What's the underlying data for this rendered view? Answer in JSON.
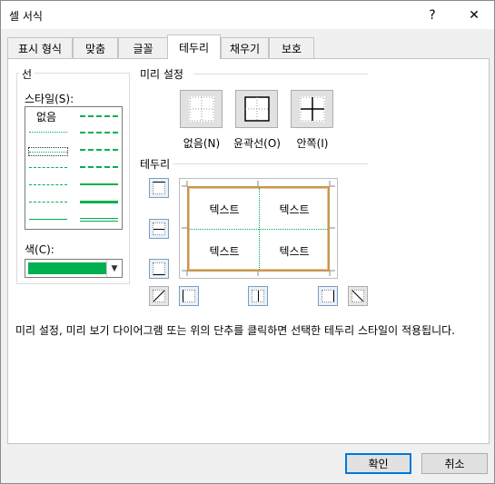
{
  "window": {
    "title": "셀 서식",
    "help": "?",
    "close": "✕"
  },
  "tabs": [
    "표시 형식",
    "맞춤",
    "글꼴",
    "테두리",
    "채우기",
    "보호"
  ],
  "active_tab": "테두리",
  "line": {
    "group_label": "선",
    "style_label": "스타일(S):",
    "none_label": "없음",
    "color_label": "색(C):",
    "color_value": "#00b050"
  },
  "presets": {
    "group_label": "미리 설정",
    "none": "없음(N)",
    "outline": "윤곽선(O)",
    "inside": "안쪽(I)"
  },
  "border": {
    "group_label": "테두리",
    "preview_texts": [
      "텍스트",
      "텍스트",
      "텍스트",
      "텍스트"
    ],
    "accent_color": "#c9964f"
  },
  "description": "미리 설정, 미리 보기 다이어그램 또는 위의 단추를 클릭하면 선택한 테두리 스타일이 적용됩니다.",
  "buttons": {
    "ok": "확인",
    "cancel": "취소"
  },
  "colors": {
    "focus_border": "#0078d7",
    "line_green": "#00b050"
  }
}
